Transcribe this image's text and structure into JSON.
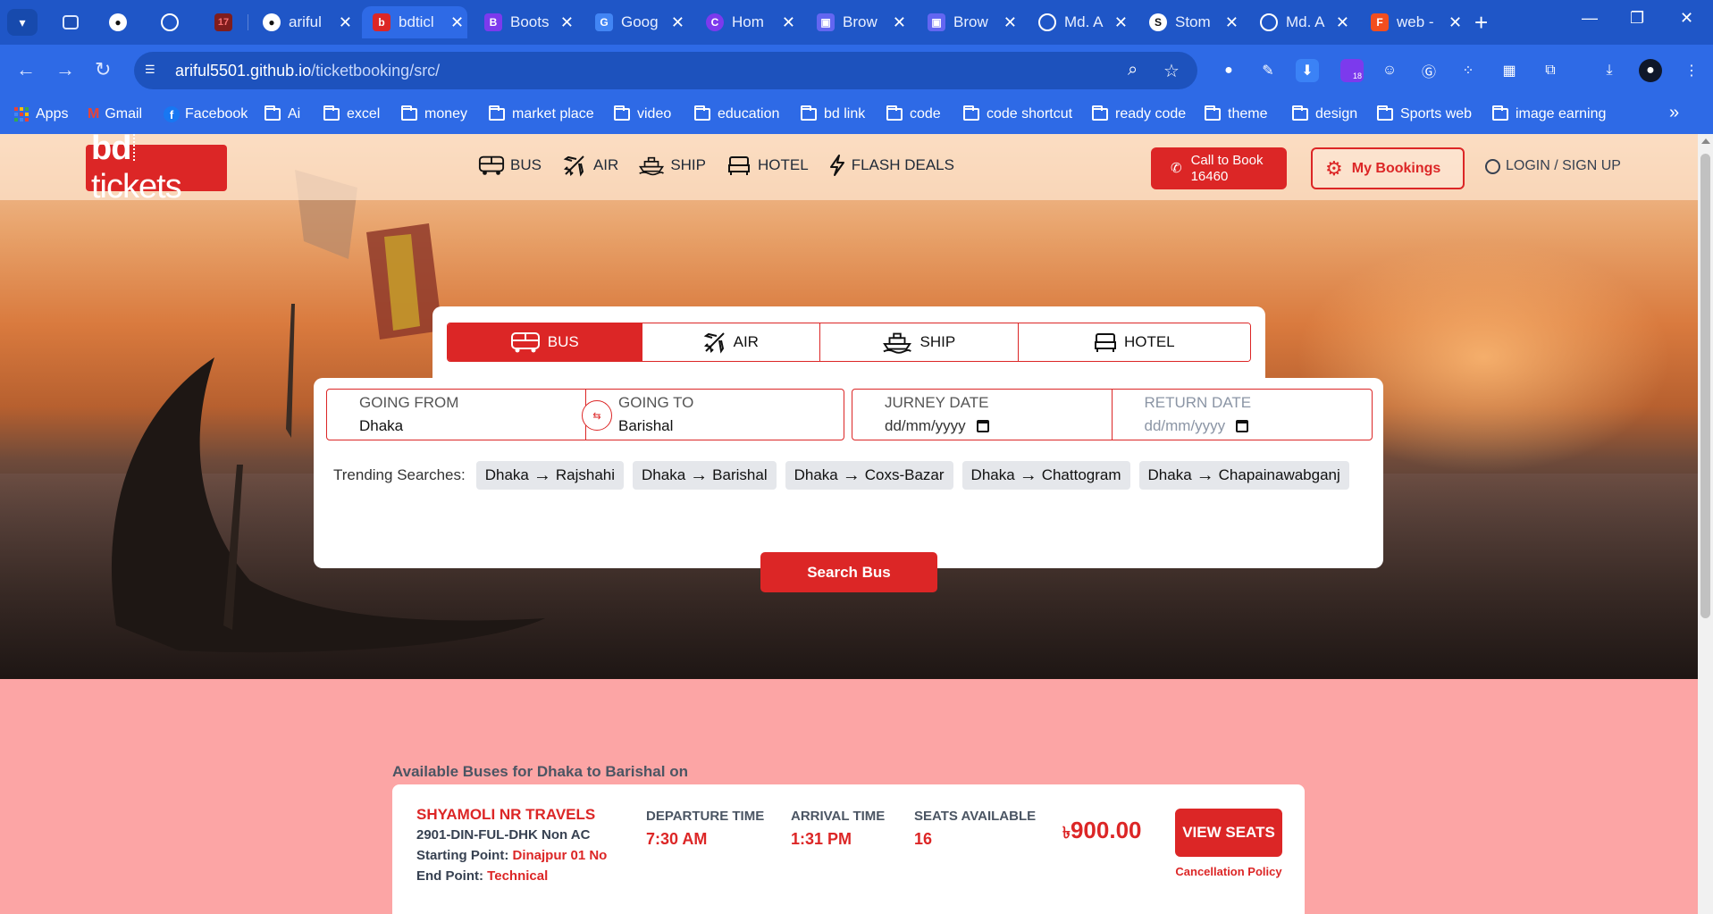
{
  "browser": {
    "tabs": [
      {
        "label": "",
        "favicon": "profile-icon",
        "color": "#1f56c7"
      },
      {
        "label": "",
        "favicon": "github-icon",
        "color": "#1f56c7"
      },
      {
        "label": "",
        "favicon": "globe-icon",
        "color": "#1f56c7"
      },
      {
        "label": "",
        "favicon": "favicon-icon",
        "color": "#1f56c7"
      },
      {
        "label": "ariful",
        "favicon": "github-icon",
        "color": "#1f56c7"
      },
      {
        "label": "bdticl",
        "favicon": "bdtickets-icon",
        "color": "#dc2626"
      },
      {
        "label": "Boots",
        "favicon": "bootstrap-icon",
        "color": "#7c3aed"
      },
      {
        "label": "Goog",
        "favicon": "google-translate-icon",
        "color": "#4285f4"
      },
      {
        "label": "Hom",
        "favicon": "canva-icon",
        "color": "#7c3aed"
      },
      {
        "label": "Brow",
        "favicon": "extension-icon",
        "color": "#6366f1"
      },
      {
        "label": "Brow",
        "favicon": "extension-icon",
        "color": "#6366f1"
      },
      {
        "label": "Md. A",
        "favicon": "globe-icon",
        "color": "#1f56c7"
      },
      {
        "label": "Stom",
        "favicon": "s-icon",
        "color": "#111827"
      },
      {
        "label": "Md. A",
        "favicon": "globe-icon",
        "color": "#1f56c7"
      },
      {
        "label": "web -",
        "favicon": "figma-icon",
        "color": "#f24e1e"
      }
    ],
    "url_host": "ariful5501.github.io",
    "url_path": "/ticketbooking/src/",
    "extension_badge": "18",
    "bookmarks": [
      "Apps",
      "Gmail",
      "Facebook",
      "Ai",
      "excel",
      "money",
      "market place",
      "video",
      "education",
      "bd link",
      "code",
      "code shortcut",
      "ready code",
      "theme",
      "design",
      "Sports web",
      "image earning"
    ]
  },
  "header": {
    "logo_bd": "bd",
    "logo_tickets": "tickets",
    "nav": [
      {
        "label": "BUS",
        "icon": "bus-icon"
      },
      {
        "label": "AIR",
        "icon": "plane-icon"
      },
      {
        "label": "SHIP",
        "icon": "ship-icon"
      },
      {
        "label": "HOTEL",
        "icon": "bed-icon"
      },
      {
        "label": "FLASH DEALS",
        "icon": "flash-icon"
      }
    ],
    "call_label_1": "Call to Book",
    "call_number": "16460",
    "my_bookings": "My Bookings",
    "login": "LOGIN / SIGN UP"
  },
  "search": {
    "modes": [
      {
        "label": "BUS",
        "active": true
      },
      {
        "label": "AIR",
        "active": false
      },
      {
        "label": "SHIP",
        "active": false
      },
      {
        "label": "HOTEL",
        "active": false
      }
    ],
    "from_label": "GOING FROM",
    "from_value": "Dhaka",
    "to_label": "GOING TO",
    "to_value": "Barishal",
    "journey_label": "JURNEY DATE",
    "journey_placeholder": "dd/mm/yyyy",
    "return_label": "RETURN DATE",
    "return_placeholder": "dd/mm/yyyy",
    "trending_label": "Trending Searches:",
    "trending": [
      {
        "from": "Dhaka",
        "to": "Rajshahi"
      },
      {
        "from": "Dhaka",
        "to": "Barishal"
      },
      {
        "from": "Dhaka",
        "to": "Coxs-Bazar"
      },
      {
        "from": "Dhaka",
        "to": "Chattogram"
      },
      {
        "from": "Dhaka",
        "to": "Chapainawabganj"
      }
    ],
    "button": "Search Bus"
  },
  "results": {
    "title": "Available Buses for Dhaka to Barishal on",
    "buses": [
      {
        "operator": "SHYAMOLI NR TRAVELS",
        "coach": "2901-DIN-FUL-DHK Non AC",
        "start_label": "Starting Point:",
        "start_value": "Dinajpur 01 No",
        "end_label": "End Point:",
        "end_value": "Technical",
        "departure_label": "DEPARTURE TIME",
        "departure": "7:30 AM",
        "arrival_label": "ARRIVAL TIME",
        "arrival": "1:31 PM",
        "seats_label": "SEATS AVAILABLE",
        "seats": "16",
        "currency": "৳",
        "price": "900.00",
        "button": "VIEW SEATS",
        "cancel": "Cancellation Policy"
      }
    ]
  },
  "colors": {
    "brand": "#dc2626",
    "browser": "#2e6ae6",
    "page_bg": "#fca5a5"
  }
}
